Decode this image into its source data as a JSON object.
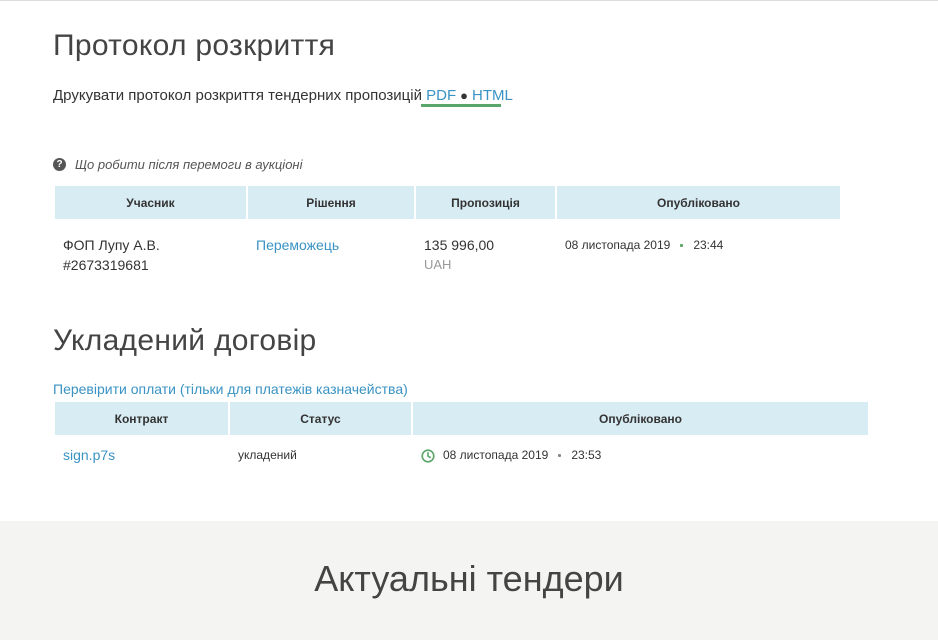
{
  "protocol": {
    "title": "Протокол розкриття",
    "print_text": "Друкувати протокол розкриття тендерних пропозицій",
    "pdf_link": "PDF",
    "html_link": "HTML",
    "separator": "●"
  },
  "help": {
    "text": "Що робити після перемоги в аукціоні"
  },
  "bids_table": {
    "headers": [
      "Учасник",
      "Рішення",
      "Пропозиція",
      "Опубліковано"
    ],
    "rows": [
      {
        "participant_name": "ФОП Лупу А.В.",
        "participant_id": "#2673319681",
        "decision": "Переможець",
        "amount": "135 996,00",
        "currency": "UAH",
        "date": "08 листопада 2019",
        "time": "23:44"
      }
    ]
  },
  "contract": {
    "title": "Укладений договір",
    "check_link": "Перевірити оплати (тільки для платежів казначейства)",
    "headers": [
      "Контракт",
      "Статус",
      "Опубліковано"
    ],
    "rows": [
      {
        "file": "sign.p7s",
        "status": "укладений",
        "date": "08 листопада 2019",
        "time": "23:53"
      }
    ]
  },
  "footer": {
    "title": "Актуальні тендери"
  },
  "colors": {
    "link": "#3a93c4",
    "header_bg": "#d8ecf3",
    "accent_green": "#5aa56a",
    "footer_bg": "#f4f4f2"
  }
}
